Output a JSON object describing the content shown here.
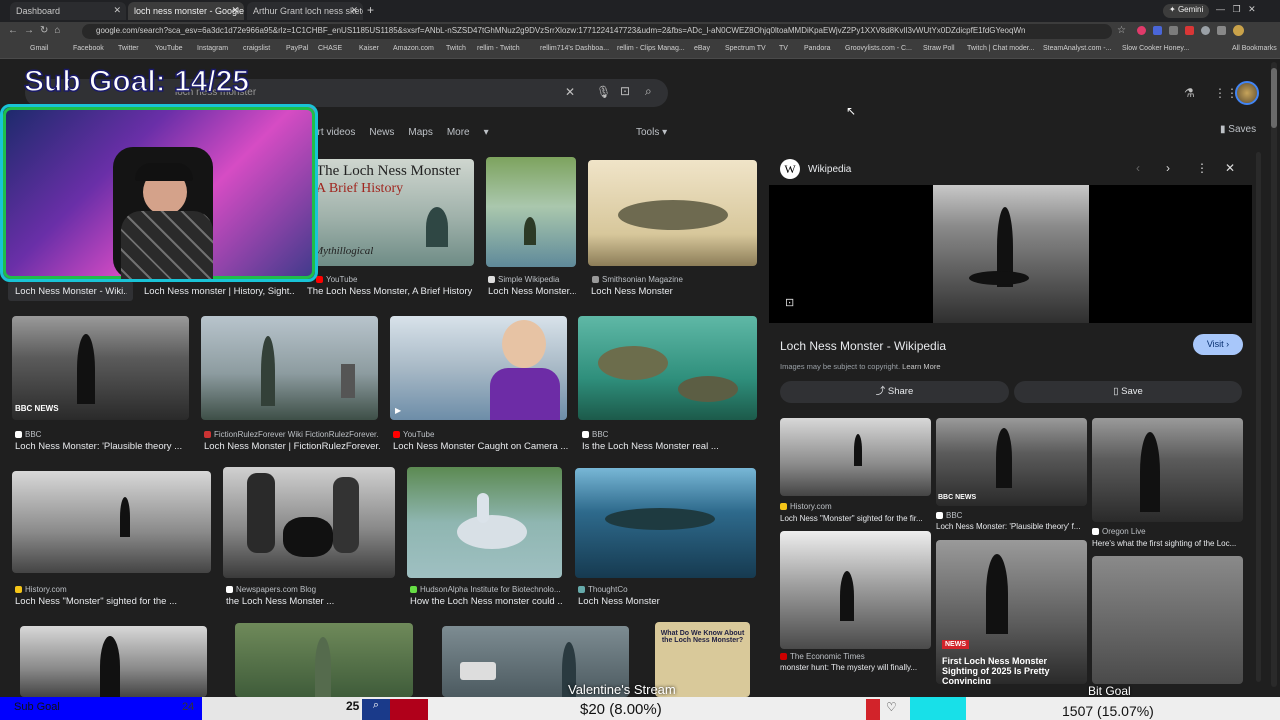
{
  "browser": {
    "tabs": [
      {
        "label": "Dashboard"
      },
      {
        "label": "loch ness monster - Google Se..."
      },
      {
        "label": "Arthur Grant loch ness sketch ..."
      }
    ],
    "gemini_label": "Gemini",
    "url": "google.com/search?sca_esv=6a3dc1d72e966a95&rlz=1C1CHBF_enUS1185US1185&sxsrf=ANbL-nSZSD47tGhMNuz2g9DVzSrrXlozw:1771224147723&udm=2&fbs=ADc_l-aN0CWEZ8Ohjq0ltoaMMDiKpaEWjvZ2Py1XXV8d8KvlI3vWUtYx0DZdicpfE1fdGYeoqWn",
    "bookmarks": [
      "Gmail",
      "Facebook",
      "Twitter",
      "YouTube",
      "Instagram",
      "craigslist",
      "PayPal",
      "CHASE",
      "Kaiser",
      "Amazon.com",
      "Twitch",
      "rellim - Twitch",
      "rellim714's Dashboa...",
      "rellim - Clips Manag...",
      "eBay",
      "Spectrum TV",
      "TV",
      "Pandora",
      "Groovylists.com - C...",
      "Straw Poll",
      "Twitch | Chat moder...",
      "SteamAnalyst.com -...",
      "Slow Cooker Honey...",
      "All Bookmarks"
    ]
  },
  "overlay": {
    "sub_goal_title": "Sub Goal: 14/25",
    "bottom_sub_goal": "Sub Goal",
    "bottom_sub_count": "25",
    "bottom_sub_small": "24",
    "money": "$20 (8.00%)",
    "stream_title": "Valentine's Stream",
    "bit_goal_label": "Bit Goal",
    "bits": "1507 (15.07%)",
    "sub_progress": 0.56,
    "bit_progress": 0.15
  },
  "search": {
    "query": "loch ness monster",
    "filters": [
      "ort videos",
      "News",
      "Maps",
      "More"
    ],
    "tools": "Tools"
  },
  "results": {
    "row1": [
      {
        "source": "",
        "title": "Loch Ness Monster - Wiki..."
      },
      {
        "source": "",
        "title": "Loch Ness monster | History, Sight..."
      },
      {
        "source": "YouTube",
        "title": "The Loch Ness Monster, A Brief History...",
        "img_text": "The Loch Ness Monster",
        "img_sub": "A Brief History",
        "img_brand": "Mythillogical"
      },
      {
        "source": "Simple Wikipedia",
        "title": "Loch Ness Monster..."
      },
      {
        "source": "Smithsonian Magazine",
        "title": "Loch Ness Monster"
      }
    ],
    "row2": [
      {
        "source": "BBC",
        "title": "Loch Ness Monster: 'Plausible theory ...",
        "badge": "BBC NEWS"
      },
      {
        "source": "FictionRulezForever Wiki FictionRulezForever...",
        "title": "Loch Ness Monster | FictionRulezForever..."
      },
      {
        "source": "YouTube",
        "title": "Loch Ness Monster Caught on Camera ..."
      },
      {
        "source": "BBC",
        "title": "Is the Loch Ness Monster real ..."
      }
    ],
    "row3": [
      {
        "source": "History.com",
        "title": "Loch Ness \"Monster\" sighted for the ..."
      },
      {
        "source": "Newspapers.com Blog",
        "title": "the Loch Ness Monster ..."
      },
      {
        "source": "HudsonAlpha Institute for Biotechnolo...",
        "title": "How the Loch Ness monster could ..."
      },
      {
        "source": "ThoughtCo",
        "title": "Loch Ness Monster"
      }
    ],
    "row4_book_text": "What Do We Know About the Loch Ness Monster?"
  },
  "panel": {
    "source": "Wikipedia",
    "title": "Loch Ness Monster - Wikipedia",
    "visit": "Visit",
    "copyright": "Images may be subject to copyright.",
    "learn_more": "Learn More",
    "share": "Share",
    "save": "Save",
    "related": [
      {
        "source": "History.com",
        "title": "Loch Ness \"Monster\" sighted for the fir..."
      },
      {
        "source": "BBC",
        "title": "Loch Ness Monster: 'Plausible theory' f...",
        "badge": "BBC NEWS"
      },
      {
        "source": "Oregon Live",
        "title": "Here's what the first sighting of the Loc..."
      },
      {
        "source": "The Economic Times",
        "title": "monster hunt: The mystery will finally..."
      },
      {
        "source": "",
        "title": "First Loch Ness Monster Sighting of 2025 Is Pretty Convincing",
        "badge": "NEWS"
      }
    ]
  },
  "header": {
    "saves": "Saves"
  },
  "colors": {
    "accent_blue": "#a8c7fa",
    "hud_blue": "#0000ff",
    "hud_cyan": "#18e0e8",
    "hud_red": "#b0001a",
    "webcam_border": "#19c3d6"
  }
}
